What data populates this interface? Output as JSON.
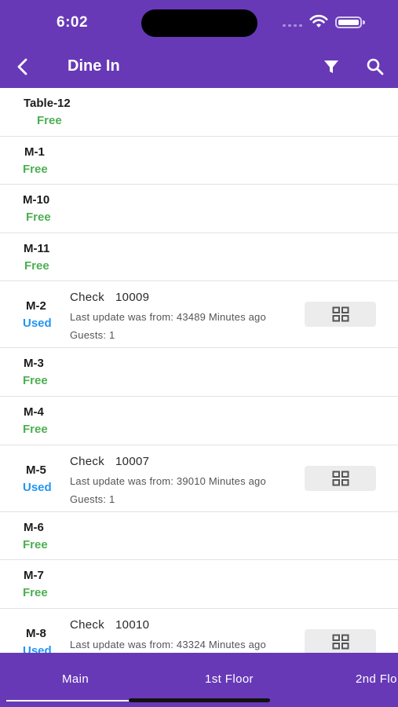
{
  "status_bar": {
    "time": "6:02"
  },
  "header": {
    "title": "Dine In",
    "icons": {
      "back": "back-arrow-icon",
      "filter": "filter-icon",
      "search": "search-icon"
    }
  },
  "colors": {
    "brand": "#6739b7",
    "free": "#4caf50",
    "used": "#2196f3"
  },
  "tables": [
    {
      "name": "Table-12",
      "status": "Free"
    },
    {
      "name": "M-1",
      "status": "Free"
    },
    {
      "name": "M-10",
      "status": "Free"
    },
    {
      "name": "M-11",
      "status": "Free"
    },
    {
      "name": "M-2",
      "status": "Used",
      "check_label": "Check",
      "check_number": "10009",
      "last_update": "Last update was from: 43489 Minutes ago",
      "guests": "Guests: 1"
    },
    {
      "name": "M-3",
      "status": "Free"
    },
    {
      "name": "M-4",
      "status": "Free"
    },
    {
      "name": "M-5",
      "status": "Used",
      "check_label": "Check",
      "check_number": "10007",
      "last_update": "Last update was from: 39010 Minutes ago",
      "guests": "Guests: 1"
    },
    {
      "name": "M-6",
      "status": "Free"
    },
    {
      "name": "M-7",
      "status": "Free"
    },
    {
      "name": "M-8",
      "status": "Used",
      "check_label": "Check",
      "check_number": "10010",
      "last_update": "Last update was from: 43324 Minutes ago",
      "guests": ""
    }
  ],
  "tabs": [
    {
      "label": "Main",
      "selected": true
    },
    {
      "label": "1st Floor",
      "selected": false
    },
    {
      "label": "2nd Flo",
      "selected": false
    }
  ]
}
